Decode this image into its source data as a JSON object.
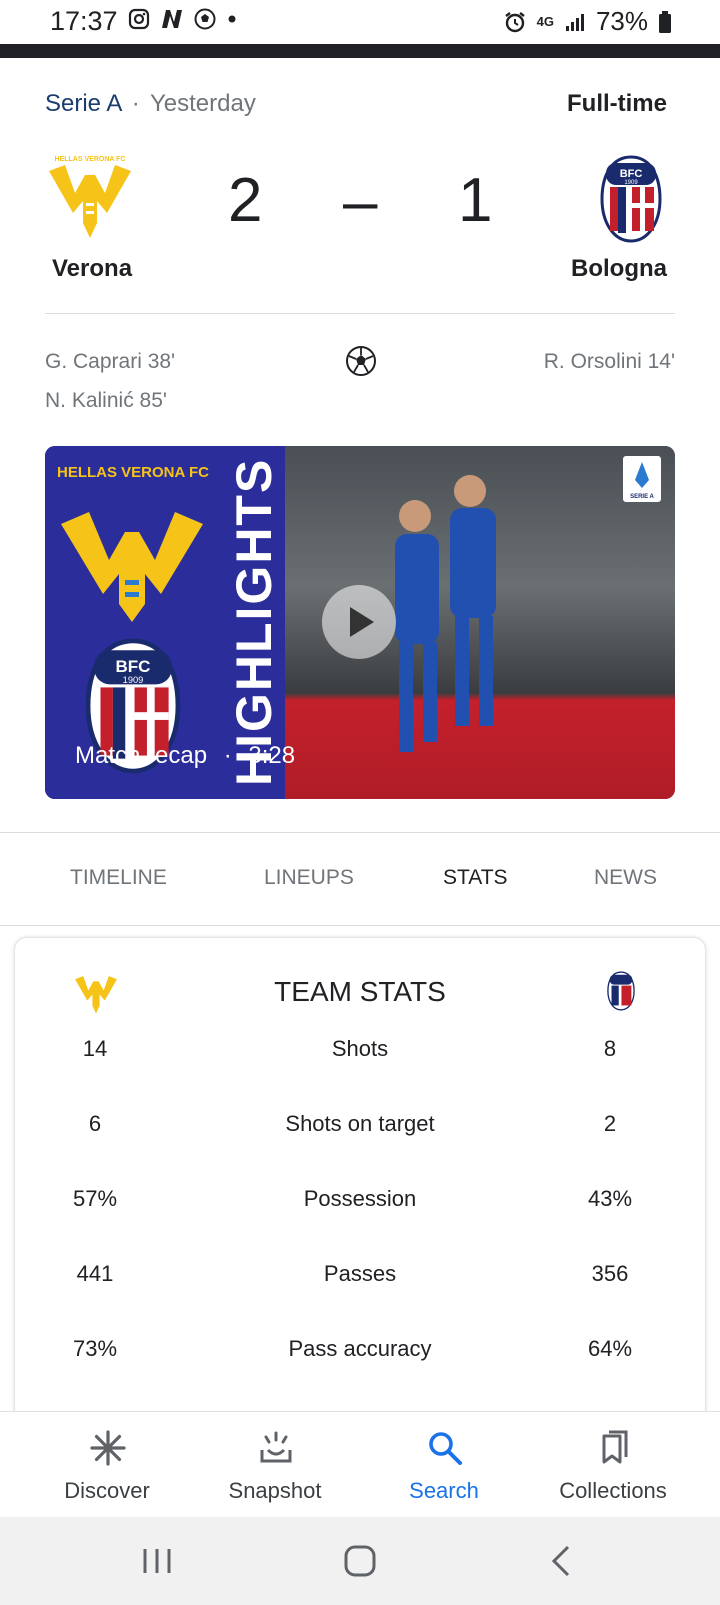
{
  "status_bar": {
    "time": "17:37",
    "network": "4G",
    "battery": "73%",
    "left_icons": [
      "instagram-icon",
      "n-app-icon",
      "soccer-ball-icon",
      "notification-dot-icon"
    ],
    "right_icons": [
      "alarm-icon",
      "network-4g-icon",
      "signal-icon",
      "battery-icon"
    ]
  },
  "match": {
    "league": "Serie A",
    "separator": "·",
    "date": "Yesterday",
    "status": "Full-time",
    "home": {
      "name": "Verona",
      "score": "2",
      "logo_text": "HELLAS VERONA FC",
      "color": "#f6c418"
    },
    "away": {
      "name": "Bologna",
      "score": "1",
      "logo_text": "BFC 1909",
      "color": "#1a2b6d"
    },
    "score_separator": "–",
    "home_scorers": [
      "G. Caprari 38'",
      "N. Kalinić 85'"
    ],
    "away_scorers": [
      "R. Orsolini 14'"
    ]
  },
  "video": {
    "brand_text": "HELLAS VERONA FC",
    "overlay_text": "HIGHLIGHTS",
    "label": "Match recap",
    "dot": "·",
    "duration": "3:28",
    "badge_text": "SERIE A"
  },
  "tabs": [
    {
      "label": "TIMELINE",
      "active": false
    },
    {
      "label": "LINEUPS",
      "active": false
    },
    {
      "label": "STATS",
      "active": true
    },
    {
      "label": "NEWS",
      "active": false
    }
  ],
  "team_stats": {
    "title": "TEAM STATS",
    "rows": [
      {
        "home": "14",
        "label": "Shots",
        "away": "8"
      },
      {
        "home": "6",
        "label": "Shots on target",
        "away": "2"
      },
      {
        "home": "57%",
        "label": "Possession",
        "away": "43%"
      },
      {
        "home": "441",
        "label": "Passes",
        "away": "356"
      },
      {
        "home": "73%",
        "label": "Pass accuracy",
        "away": "64%"
      }
    ]
  },
  "bottom_nav": [
    {
      "label": "Discover",
      "icon": "discover-icon",
      "active": false
    },
    {
      "label": "Snapshot",
      "icon": "snapshot-icon",
      "active": false
    },
    {
      "label": "Search",
      "icon": "search-icon",
      "active": true
    },
    {
      "label": "Collections",
      "icon": "collections-icon",
      "active": false
    }
  ],
  "colors": {
    "accent": "#1a73e8",
    "league": "#1a3d6e",
    "muted": "#70757a"
  }
}
